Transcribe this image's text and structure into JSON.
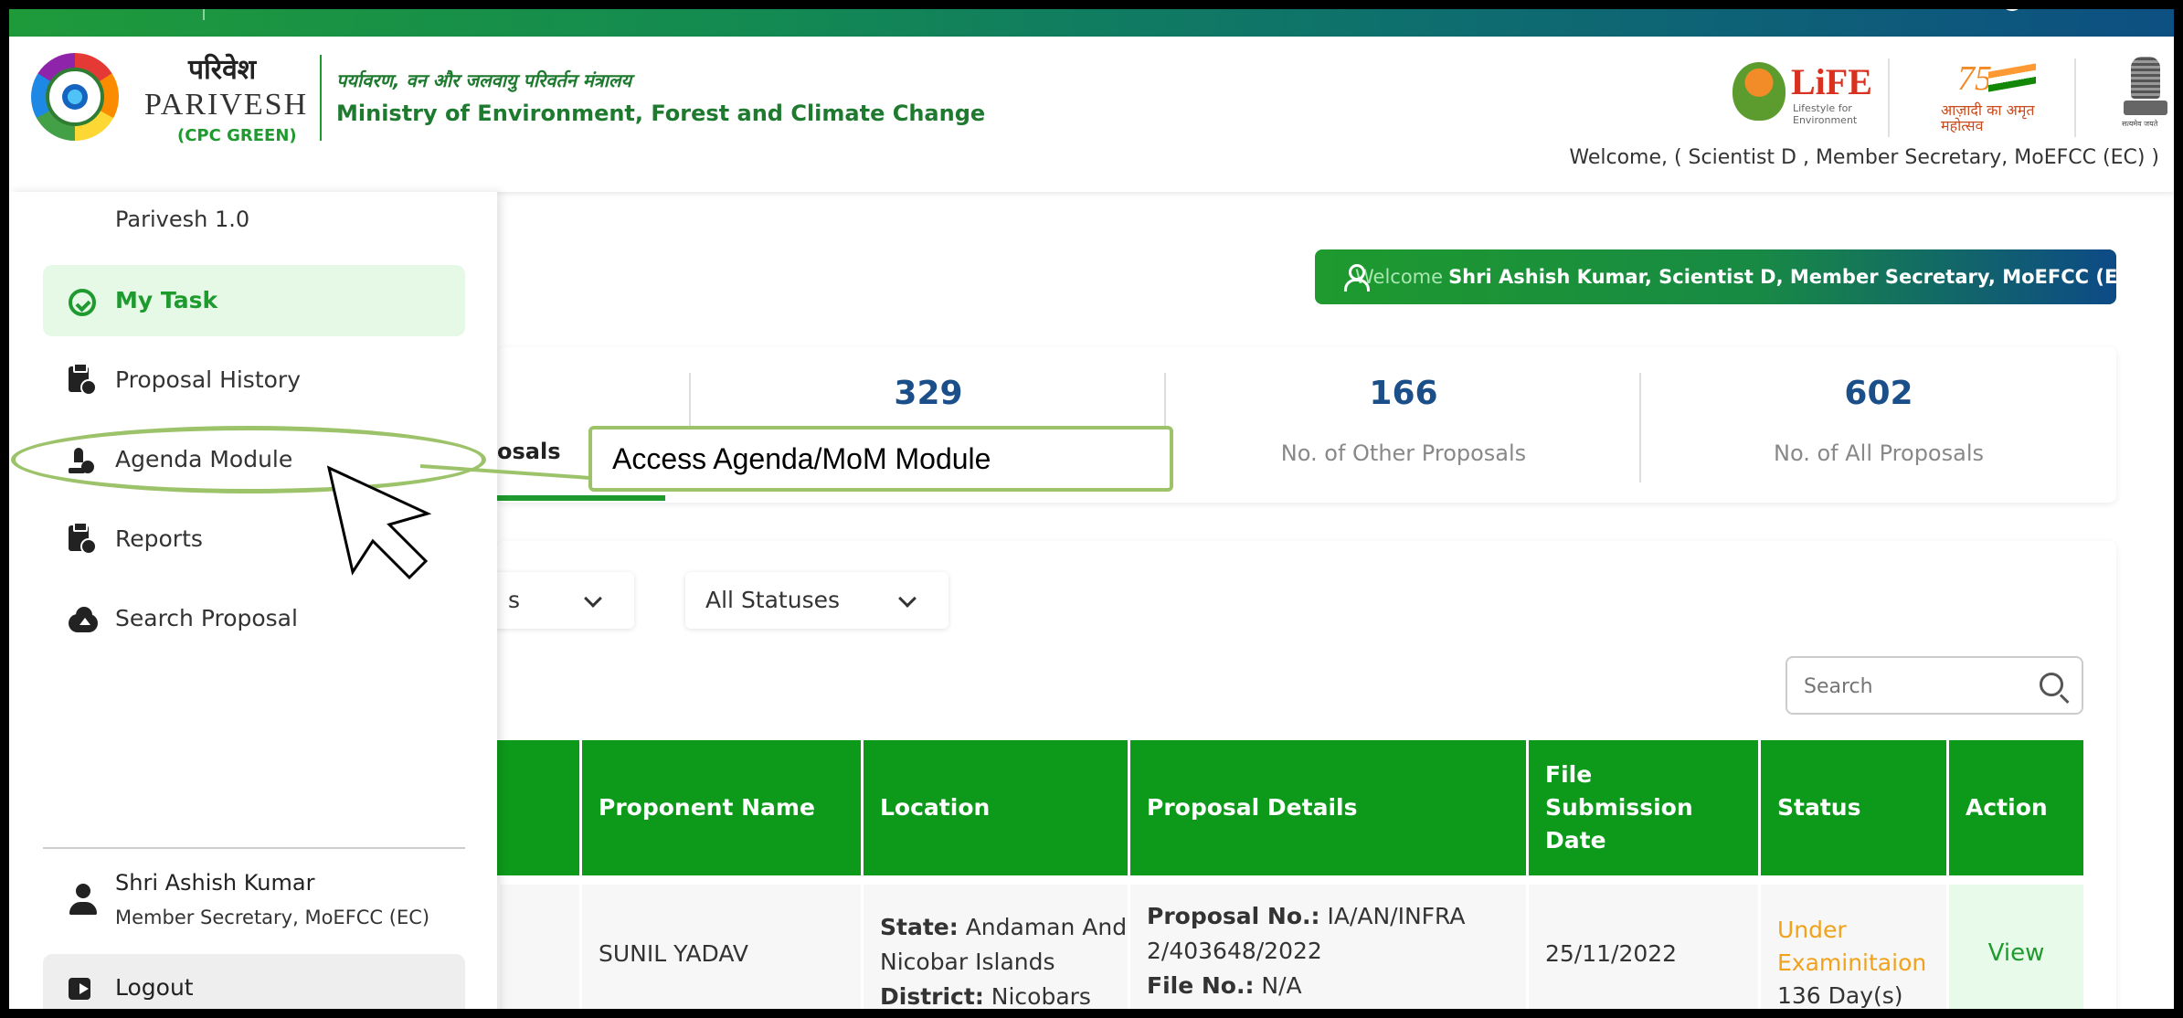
{
  "header": {
    "brand_hindi": "परिवेश",
    "brand_name": "PARIVESH",
    "brand_sub": "(CPC GREEN)",
    "ministry_hindi": "पर्यावरण, वन और जलवायु परिवर्तन मंत्रालय",
    "ministry_en": "Ministry of Environment, Forest and Climate Change",
    "life_logo_text": "LiFE",
    "life_tagline": "Lifestyle for Environment",
    "azadi_number": "75",
    "azadi_text": "आज़ादी का अमृत महोत्सव",
    "emblem_text": "सत्यमेव जयते",
    "welcome_role": "Welcome, ( Scientist D , Member Secretary, MoEFCC (EC) )"
  },
  "sidebar": {
    "version": "Parivesh 1.0",
    "items": [
      {
        "label": "My Task",
        "icon": "gauge-check-icon",
        "active": true
      },
      {
        "label": "Proposal History",
        "icon": "clipboard-clock-icon"
      },
      {
        "label": "Agenda Module",
        "icon": "user-check-icon"
      },
      {
        "label": "Reports",
        "icon": "clipboard-clock-icon"
      },
      {
        "label": "Search Proposal",
        "icon": "cloud-upload-icon"
      }
    ],
    "user": {
      "name": "Shri Ashish Kumar",
      "role": "Member Secretary, MoEFCC (EC)"
    },
    "logout_label": "Logout"
  },
  "welcome_banner": {
    "prefix": "Welcome",
    "name": "Shri Ashish Kumar, Scientist D, Member Secretary, MoEFCC (EC)"
  },
  "stats": {
    "tab_label_partial": "osals",
    "items": [
      {
        "value": "329",
        "label": ""
      },
      {
        "value": "166",
        "label": "No. of Other Proposals"
      },
      {
        "value": "602",
        "label": "No. of All Proposals"
      }
    ]
  },
  "filters": {
    "first_partial": "s",
    "status_label": "All Statuses"
  },
  "search": {
    "placeholder": "Search"
  },
  "table": {
    "headers": [
      "Proponent Name",
      "Location",
      "Proposal Details",
      "File Submission Date",
      "Status",
      "Action"
    ],
    "rows": [
      {
        "proponent": "SUNIL YADAV",
        "state_label": "State:",
        "state_value": "Andaman And Nicobar Islands",
        "district_label": "District:",
        "district_value": "Nicobars",
        "proposal_no_label": "Proposal No.:",
        "proposal_no_value": "IA/AN/INFRA 2/403648/2022",
        "file_no_label": "File No.:",
        "file_no_value": "N/A",
        "submission_date": "25/11/2022",
        "status": "Under Examinitaion",
        "status_days": "136 Day(s)",
        "action": "View"
      }
    ]
  },
  "annotation": {
    "callout_text": "Access Agenda/MoM Module"
  },
  "colors": {
    "primary_green": "#1e9a2e",
    "table_header_green": "#0d9a1a",
    "stat_number_blue": "#1b4f8a",
    "status_orange": "#f0a21d",
    "annotation_green": "#9dc36a"
  }
}
